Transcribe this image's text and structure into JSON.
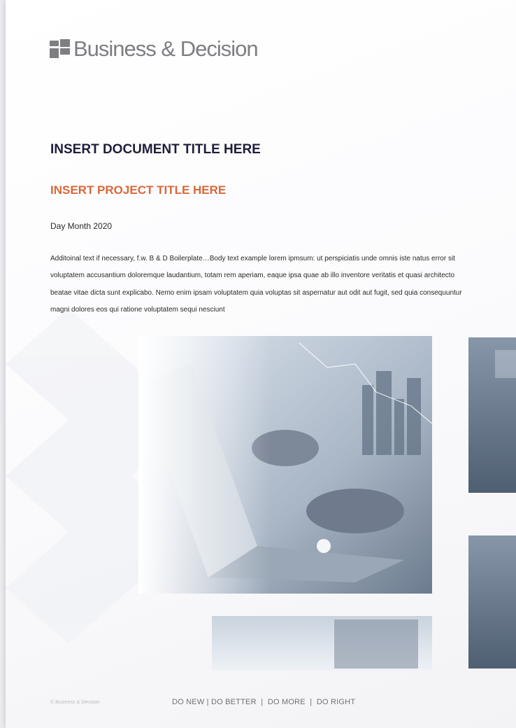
{
  "brand": {
    "logo_text": "Business & Decision"
  },
  "document": {
    "title": "INSERT DOCUMENT TITLE HERE",
    "project_title": "INSERT PROJECT TITLE HERE",
    "date": "Day Month 2020",
    "body": "Additoinal text if necessary, f.w. B & D Boilerplate…Body text example lorem ipmsum: ut perspiciatis unde omnis iste natus error sit voluptatem accusantium doloremque laudantium, totam rem aperiam, eaque ipsa quae ab illo inventore veritatis et quasi architecto beatae vitae dicta sunt explicabo. Nemo enim ipsam voluptatem quia voluptas sit aspernatur aut odit aut fugit, sed quia consequuntur magni dolores eos qui ratione voluptatem sequi nesciunt"
  },
  "footer": {
    "copyright": "© Business & Decision",
    "tagline": "DO NEW | DO BETTER  |  DO MORE  |  DO RIGHT"
  },
  "colors": {
    "title": "#1e1e3c",
    "project_title": "#d9673a",
    "logo": "#7e7e82"
  },
  "icons": {
    "logo_mark": "four-block-logo-icon"
  }
}
